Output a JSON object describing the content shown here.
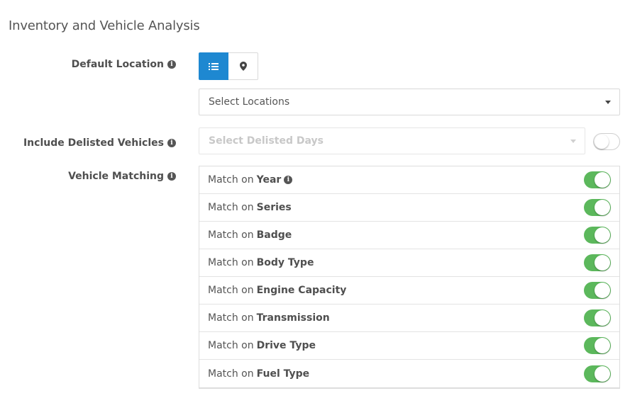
{
  "title": "Inventory and Vehicle Analysis",
  "default_location": {
    "label": "Default Location",
    "view_buttons": [
      {
        "icon": "list-icon",
        "active": true
      },
      {
        "icon": "map-marker-icon",
        "active": false
      }
    ],
    "select_placeholder": "Select Locations"
  },
  "delisted": {
    "label": "Include Delisted Vehicles",
    "select_placeholder": "Select Delisted Days",
    "toggle_on": false
  },
  "vehicle_matching": {
    "label": "Vehicle Matching",
    "prefix": "Match on",
    "items": [
      {
        "field": "Year",
        "info": true,
        "on": true
      },
      {
        "field": "Series",
        "info": false,
        "on": true
      },
      {
        "field": "Badge",
        "info": false,
        "on": true
      },
      {
        "field": "Body Type",
        "info": false,
        "on": true
      },
      {
        "field": "Engine Capacity",
        "info": false,
        "on": true
      },
      {
        "field": "Transmission",
        "info": false,
        "on": true
      },
      {
        "field": "Drive Type",
        "info": false,
        "on": true
      },
      {
        "field": "Fuel Type",
        "info": false,
        "on": true
      }
    ]
  },
  "colors": {
    "primary": "#1e88d1",
    "toggle_on": "#5cb85c"
  }
}
